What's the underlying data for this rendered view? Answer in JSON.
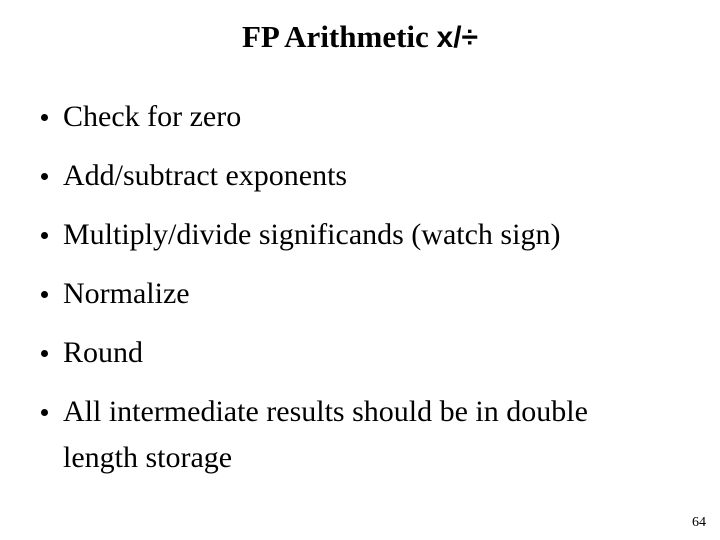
{
  "slide": {
    "title": {
      "main_text": "FP Arithmetic ",
      "symbol_text": "x/÷",
      "full_text": "FP Arithmetic x/÷"
    },
    "bullets": [
      {
        "text": "Check for zero"
      },
      {
        "text": "Add/subtract exponents"
      },
      {
        "text": "Multiply/divide significands (watch sign)"
      },
      {
        "text": "Normalize"
      },
      {
        "text": "Round"
      },
      {
        "text": "All intermediate results should be in double length storage"
      }
    ],
    "page_number": "64",
    "colors": {
      "background": "#ffffff",
      "text": "#000000",
      "bullet": "#000000"
    }
  }
}
